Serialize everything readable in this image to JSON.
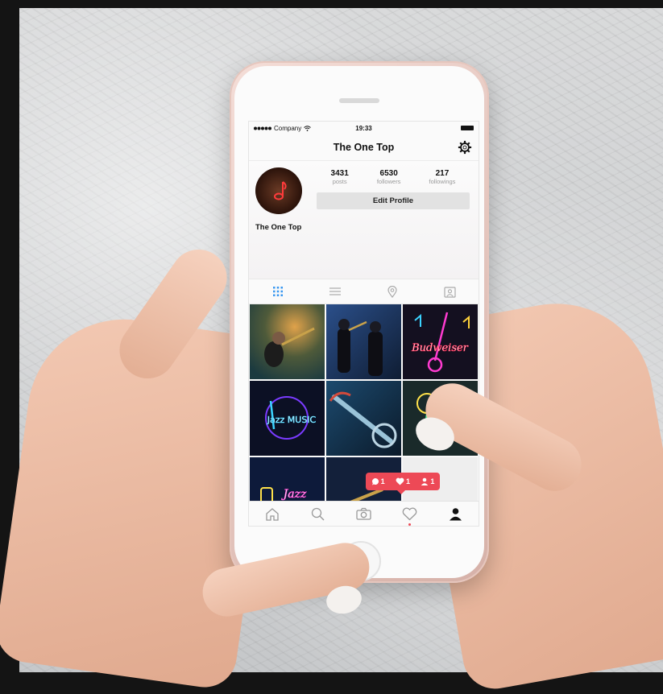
{
  "status_bar": {
    "carrier": "Company",
    "time": "19:33"
  },
  "header": {
    "title": "The One Top"
  },
  "profile": {
    "name": "The One Top",
    "stats": [
      {
        "value": "3431",
        "label": "posts"
      },
      {
        "value": "6530",
        "label": "followers"
      },
      {
        "value": "217",
        "label": "followings"
      }
    ],
    "edit_label": "Edit Profile"
  },
  "profile_tabs": [
    "grid-icon",
    "list-icon",
    "location-pin-icon",
    "tagged-person-icon"
  ],
  "notification": {
    "comments": "1",
    "likes": "1",
    "follows": "1"
  },
  "grid_tiles": [
    {
      "caption": ""
    },
    {
      "caption": ""
    },
    {
      "caption": "Budweiser"
    },
    {
      "caption": "Jazz MUSIC"
    },
    {
      "caption": ""
    },
    {
      "caption": ""
    },
    {
      "caption": "Jazz"
    },
    {
      "caption": ""
    },
    {
      "caption": ""
    }
  ],
  "bottom_nav": [
    "home-icon",
    "search-icon",
    "camera-icon",
    "heart-icon",
    "profile-icon"
  ],
  "colors": {
    "accent_red": "#ed4956",
    "active_tab_blue": "#3897f0",
    "text_dark": "#111111"
  }
}
